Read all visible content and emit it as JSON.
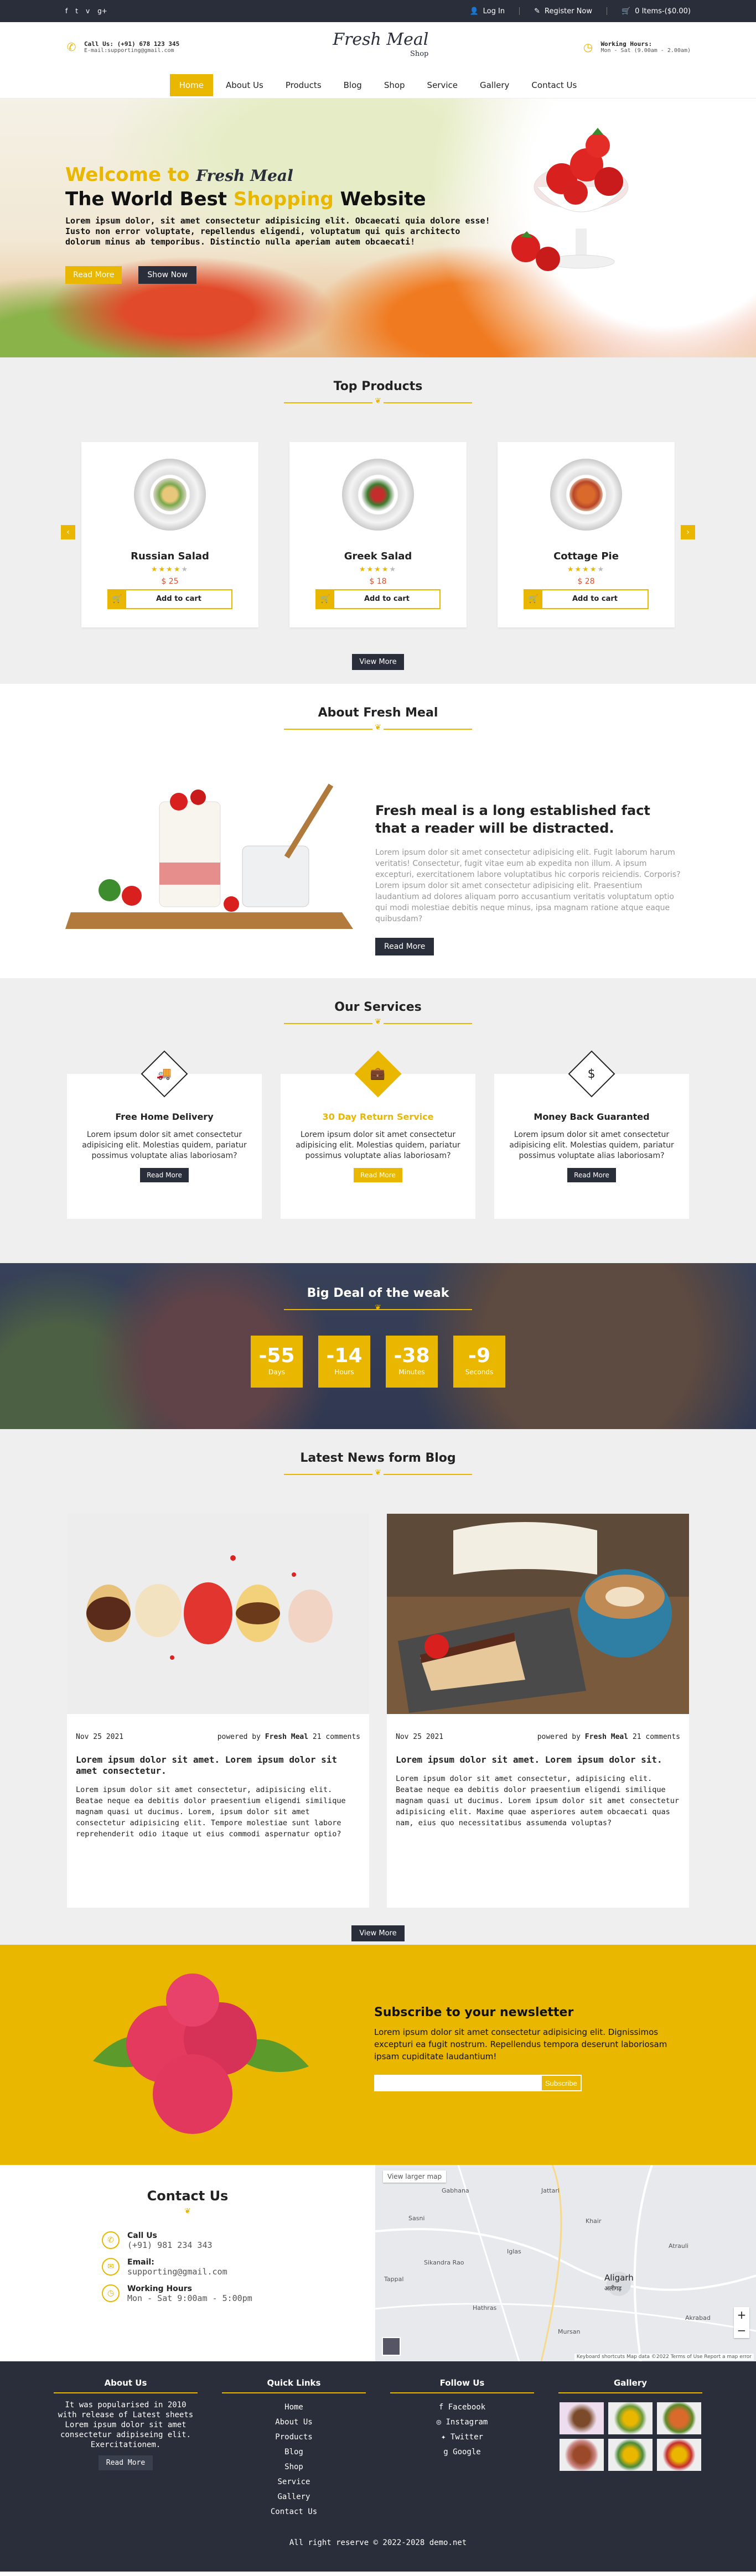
{
  "topbar": {
    "social": [
      "f",
      "t",
      "v",
      "g+"
    ],
    "login": "Log In",
    "register": "Register Now",
    "cart": "0 Items-($0.00)"
  },
  "header": {
    "call_title": "Call Us: (+91) 678 123 345",
    "call_sub": "E-mail:supporting@gmail.com",
    "logo": "Fresh Meal",
    "logo_sub": "Shop",
    "hours_title": "Working Hours:",
    "hours_sub": "Mon - Sat (9.00am - 2.00am)"
  },
  "nav": {
    "items": [
      "Home",
      "About Us",
      "Products",
      "Blog",
      "Shop",
      "Service",
      "Gallery",
      "Contact Us"
    ]
  },
  "hero": {
    "welcome": "Welcome to",
    "welcome_logo": "Fresh Meal",
    "title_pre": "The World Best",
    "title_hl": "Shopping",
    "title_post": "Website",
    "text": "Lorem ipsum dolor, sit amet consectetur adipisicing elit. Obcaecati quia dolore esse! Iusto non error voluptate, repellendus eligendi, voluptatum qui quis architecto dolorum minus ab temporibus. Distinctio nulla aperiam autem obcaecati!",
    "btn_read": "Read More",
    "btn_show": "Show Now"
  },
  "products": {
    "title": "Top Products",
    "items": [
      {
        "name": "Russian Salad",
        "price": "$ 25",
        "rating": 4
      },
      {
        "name": "Greek Salad",
        "price": "$ 18",
        "rating": 4
      },
      {
        "name": "Cottage Pie",
        "price": "$ 28",
        "rating": 4
      }
    ],
    "add_label": "Add to cart",
    "view_more": "View More"
  },
  "about": {
    "title": "About Fresh Meal",
    "heading": "Fresh meal is a long established fact that a reader will be distracted.",
    "text": "Lorem ipsum dolor sit amet consectetur adipisicing elit. Fugit laborum harum veritatis! Consectetur, fugit vitae eum ab expedita non illum. A ipsum excepturi, exercitationem labore voluptatibus hic corporis reiciendis. Corporis? Lorem ipsum dolor sit amet consectetur adipisicing elit. Praesentium laudantium ad dolores aliquam porro accusantium veritatis voluptatum optio qui modi molestiae debitis neque minus, ipsa magnam ratione atque eaque quibusdam?",
    "btn": "Read More"
  },
  "services": {
    "title": "Our Services",
    "items": [
      {
        "title": "Free Home Delivery",
        "text": "Lorem ipsum dolor sit amet consectetur adipisicing elit. Molestias quidem, pariatur possimus voluptate alias laboriosam?",
        "btn": "Read More"
      },
      {
        "title": "30 Day Return Service",
        "text": "Lorem ipsum dolor sit amet consectetur adipisicing elit. Molestias quidem, pariatur possimus voluptate alias laboriosam?",
        "btn": "Read More"
      },
      {
        "title": "Money Back Guaranted",
        "text": "Lorem ipsum dolor sit amet consectetur adipisicing elit. Molestias quidem, pariatur possimus voluptate alias laboriosam?",
        "btn": "Read More"
      }
    ]
  },
  "deal": {
    "title": "Big Deal of the weak",
    "timers": [
      {
        "n": "-55",
        "l": "Days"
      },
      {
        "n": "-14",
        "l": "Hours"
      },
      {
        "n": "-38",
        "l": "Minutes"
      },
      {
        "n": "-9",
        "l": "Seconds"
      }
    ]
  },
  "news": {
    "title": "Latest News form Blog",
    "items": [
      {
        "date": "Nov 25 2021",
        "by": "powered by",
        "author": "Fresh Meal",
        "comments": "21 comments",
        "heading": "Lorem ipsum dolor sit amet. Lorem ipsum dolor sit amet consectetur.",
        "text": "Lorem ipsum dolor sit amet consectetur, adipisicing elit. Beatae neque ea debitis dolor praesentium eligendi similique magnam quasi ut ducimus. Lorem, ipsum dolor sit amet consectetur adipisicing elit. Tempore molestiae sunt labore reprehenderit odio itaque ut eius commodi aspernatur optio?"
      },
      {
        "date": "Nov 25 2021",
        "by": "powered by",
        "author": "Fresh Meal",
        "comments": "21 comments",
        "heading": "Lorem ipsum dolor sit amet. Lorem ipsum dolor sit.",
        "text": "Lorem ipsum dolor sit amet consectetur, adipisicing elit. Beatae neque ea debitis dolor praesentium eligendi similique magnam quasi ut ducimus. Lorem ipsum dolor sit amet consectetur adipisicing elit. Maxime quae asperiores autem obcaecati quas nam, eius quo necessitatibus assumenda voluptas?"
      }
    ],
    "view_more": "View More"
  },
  "newsletter": {
    "title": "Subscribe to your newsletter",
    "text": "Lorem ipsum dolor sit amet consectetur adipisicing elit. Dignissimos excepturi ea fugit nostrum. Repellendus tempora deserunt laboriosam ipsam cupiditate laudantium!",
    "placeholder": "",
    "btn": "Subscribe"
  },
  "contact": {
    "title": "Contact Us",
    "items": [
      {
        "t": "Call Us",
        "v": "(+91) 981 234 343"
      },
      {
        "t": "Email:",
        "v": "supporting@gmail.com"
      },
      {
        "t": "Working Hours",
        "v": "Mon - Sat 9:00am - 5:00pm"
      }
    ]
  },
  "map": {
    "btn": "View larger map",
    "city": "Aligarh",
    "city_hi": "अलीगढ़",
    "footer": "Keyboard shortcuts  Map data ©2022  Terms of Use  Report a map error",
    "labels": [
      "Sikandra Rao",
      "Hathras",
      "Iglas",
      "Khair",
      "Atrauli",
      "Jattari",
      "Akrabad",
      "Sasni",
      "Tappal",
      "Mursan",
      "Gabhana"
    ]
  },
  "footer": {
    "about_title": "About Us",
    "about_text": "It was popularised in 2010 with release of Latest sheets Lorem ipsum dolor sit amet consectetur adipiseing elit. Exercitationem.",
    "about_btn": "Read More",
    "links_title": "Quick Links",
    "links": [
      "Home",
      "About Us",
      "Products",
      "Blog",
      "Shop",
      "Service",
      "Gallery",
      "Contact Us"
    ],
    "follow_title": "Follow Us",
    "follow": [
      {
        "icon": "f",
        "label": "Facebook"
      },
      {
        "icon": "◎",
        "label": "Instagram"
      },
      {
        "icon": "✦",
        "label": "Twitter"
      },
      {
        "icon": "g",
        "label": "Google"
      }
    ],
    "gallery_title": "Gallery",
    "copy": "All right reserve © 2022-2028 demo.net"
  },
  "colors": {
    "accent": "#e9b600",
    "dark": "#2a2e3a",
    "price": "#e74c2a"
  }
}
